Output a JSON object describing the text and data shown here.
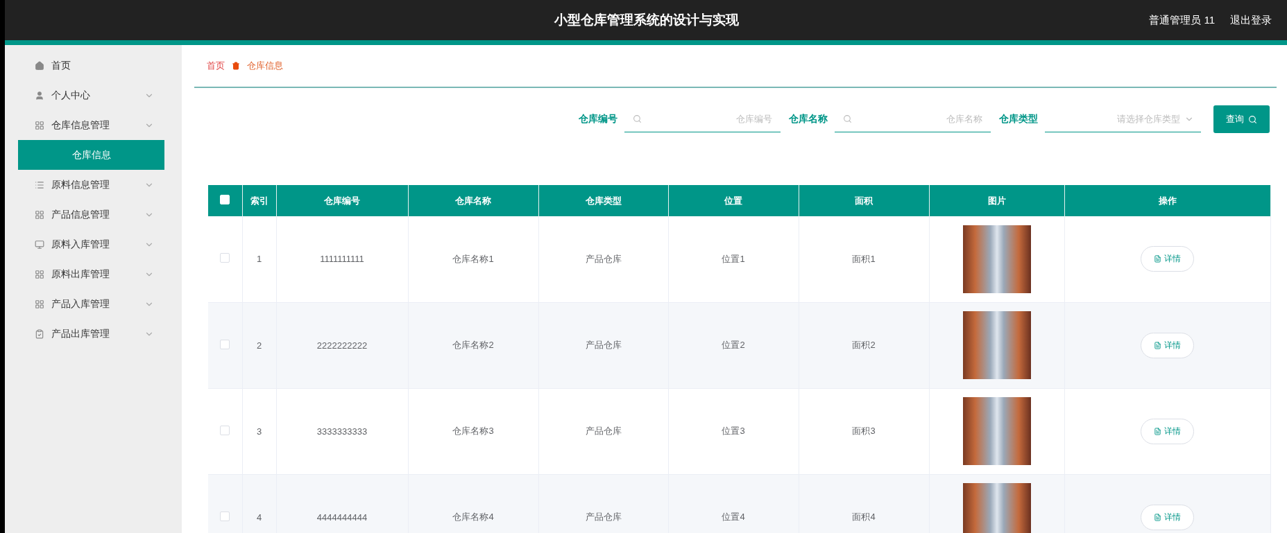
{
  "header": {
    "title": "小型仓库管理系统的设计与实现",
    "user": "普通管理员 11",
    "logout": "退出登录"
  },
  "sidebar": {
    "items": [
      {
        "label": "首页",
        "kind": "home",
        "selected": false
      },
      {
        "label": "个人中心",
        "kind": "user",
        "selected": false
      },
      {
        "label": "仓库信息管理",
        "kind": "grid",
        "selected": false,
        "children": [
          {
            "label": "仓库信息",
            "selected": true
          }
        ]
      },
      {
        "label": "原料信息管理",
        "kind": "list",
        "selected": false
      },
      {
        "label": "产品信息管理",
        "kind": "grid",
        "selected": false
      },
      {
        "label": "原料入库管理",
        "kind": "monitor",
        "selected": false
      },
      {
        "label": "原料出库管理",
        "kind": "grid",
        "selected": false
      },
      {
        "label": "产品入库管理",
        "kind": "grid",
        "selected": false
      },
      {
        "label": "产品出库管理",
        "kind": "clipboard",
        "selected": false
      }
    ]
  },
  "breadcrumb": [
    "首页",
    "仓库信息"
  ],
  "search": {
    "fields": [
      {
        "label": "仓库编号",
        "kind": "text",
        "placeholder": "仓库编号"
      },
      {
        "label": "仓库名称",
        "kind": "text",
        "placeholder": "仓库名称"
      },
      {
        "label": "仓库类型",
        "kind": "select",
        "placeholder": "请选择仓库类型"
      }
    ],
    "button": "查询"
  },
  "table": {
    "select_all_checked": false,
    "columns": [
      "索引",
      "仓库编号",
      "仓库名称",
      "仓库类型",
      "位置",
      "面积",
      "图片",
      "操作"
    ],
    "rows": [
      {
        "checked": false,
        "index": "1",
        "code": "1111111111",
        "name": "仓库名称1",
        "type": "产品仓库",
        "position": "位置1",
        "area": "面积1",
        "action": "详情"
      },
      {
        "checked": false,
        "index": "2",
        "code": "2222222222",
        "name": "仓库名称2",
        "type": "产品仓库",
        "position": "位置2",
        "area": "面积2",
        "action": "详情"
      },
      {
        "checked": false,
        "index": "3",
        "code": "3333333333",
        "name": "仓库名称3",
        "type": "产品仓库",
        "position": "位置3",
        "area": "面积3",
        "action": "详情"
      },
      {
        "checked": false,
        "index": "4",
        "code": "4444444444",
        "name": "仓库名称4",
        "type": "产品仓库",
        "position": "位置4",
        "area": "面积4",
        "action": "详情"
      }
    ]
  }
}
